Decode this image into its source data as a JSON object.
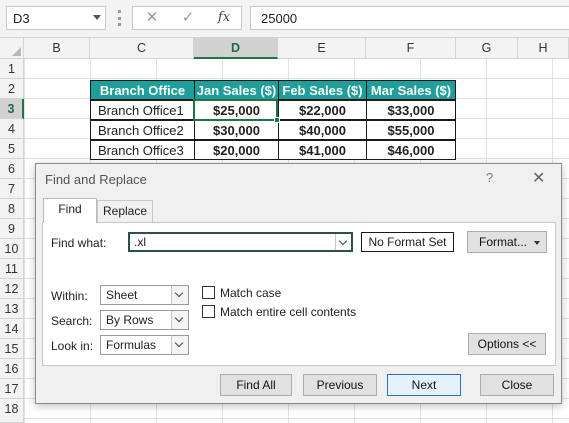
{
  "formula_bar": {
    "name_box": "D3",
    "cancel_icon": "✕",
    "enter_icon": "✓",
    "fx_label": "fx",
    "value": "25000"
  },
  "columns": [
    "B",
    "C",
    "D",
    "E",
    "F",
    "G",
    "H"
  ],
  "selected_column": "D",
  "rows": [
    "1",
    "2",
    "3",
    "4",
    "5",
    "6",
    "7",
    "8",
    "9",
    "10",
    "11",
    "12",
    "13",
    "14",
    "15",
    "16",
    "17",
    "18"
  ],
  "selected_row": "3",
  "table": {
    "headers": [
      "Branch Office",
      "Jan Sales ($)",
      "Feb Sales ($)",
      "Mar Sales ($)"
    ],
    "rows": [
      [
        "Branch Office1",
        "$25,000",
        "$22,000",
        "$33,000"
      ],
      [
        "Branch Office2",
        "$30,000",
        "$40,000",
        "$55,000"
      ],
      [
        "Branch Office3",
        "$20,000",
        "$41,000",
        "$46,000"
      ]
    ],
    "header_color": "#1f9e9a"
  },
  "dialog": {
    "title": "Find and Replace",
    "help": "?",
    "close": "✕",
    "tabs": [
      {
        "label": "Find",
        "active": true
      },
      {
        "label": "Replace",
        "active": false
      }
    ],
    "find_what_label": "Find what:",
    "find_what_value": ".xl",
    "format_status": "No Format Set",
    "format_button": "Format...",
    "within_label": "Within:",
    "within_value": "Sheet",
    "search_label": "Search:",
    "search_value": "By Rows",
    "lookin_label": "Look in:",
    "lookin_value": "Formulas",
    "match_case": {
      "label": "Match case",
      "checked": false
    },
    "match_entire": {
      "label": "Match entire cell contents",
      "checked": false
    },
    "options_button": "Options <<",
    "buttons": {
      "find_all": "Find All",
      "previous": "Previous",
      "next": "Next",
      "close": "Close"
    }
  },
  "accent_color": "#217346"
}
